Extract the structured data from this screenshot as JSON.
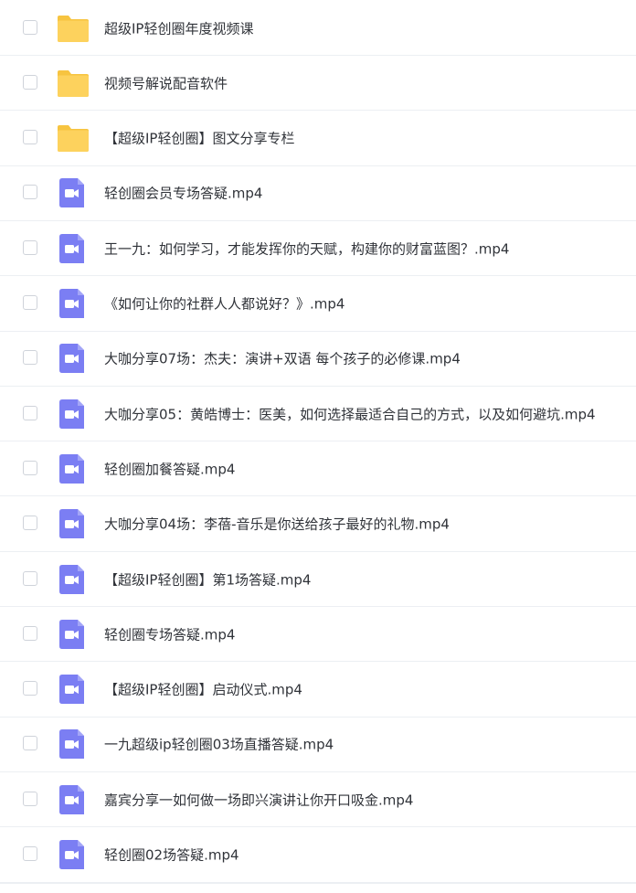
{
  "colors": {
    "folder": "#fdd25d",
    "folder_tab": "#f7c440",
    "video": "#7b7ef3",
    "text": "#303339",
    "divider": "#eceff3",
    "checkbox_border": "#cfd3da"
  },
  "files": [
    {
      "name": "超级IP轻创圈年度视频课",
      "type": "folder",
      "icon": "folder-icon"
    },
    {
      "name": "视频号解说配音软件",
      "type": "folder",
      "icon": "folder-icon"
    },
    {
      "name": "【超级IP轻创圈】图文分享专栏",
      "type": "folder",
      "icon": "folder-icon"
    },
    {
      "name": "轻创圈会员专场答疑.mp4",
      "type": "video",
      "icon": "video-file-icon"
    },
    {
      "name": "王一九：如何学习，才能发挥你的天赋，构建你的财富蓝图？.mp4",
      "type": "video",
      "icon": "video-file-icon"
    },
    {
      "name": "《如何让你的社群人人都说好？》.mp4",
      "type": "video",
      "icon": "video-file-icon"
    },
    {
      "name": "大咖分享07场：杰夫：演讲+双语 每个孩子的必修课.mp4",
      "type": "video",
      "icon": "video-file-icon"
    },
    {
      "name": "大咖分享05：黄皓博士：医美，如何选择最适合自己的方式，以及如何避坑.mp4",
      "type": "video",
      "icon": "video-file-icon"
    },
    {
      "name": "轻创圈加餐答疑.mp4",
      "type": "video",
      "icon": "video-file-icon"
    },
    {
      "name": "大咖分享04场：李蓓-音乐是你送给孩子最好的礼物.mp4",
      "type": "video",
      "icon": "video-file-icon"
    },
    {
      "name": "【超级IP轻创圈】第1场答疑.mp4",
      "type": "video",
      "icon": "video-file-icon"
    },
    {
      "name": "轻创圈专场答疑.mp4",
      "type": "video",
      "icon": "video-file-icon"
    },
    {
      "name": "【超级IP轻创圈】启动仪式.mp4",
      "type": "video",
      "icon": "video-file-icon"
    },
    {
      "name": "一九超级ip轻创圈03场直播答疑.mp4",
      "type": "video",
      "icon": "video-file-icon"
    },
    {
      "name": "嘉宾分享一如何做一场即兴演讲让你开口吸金.mp4",
      "type": "video",
      "icon": "video-file-icon"
    },
    {
      "name": "轻创圈02场答疑.mp4",
      "type": "video",
      "icon": "video-file-icon"
    }
  ]
}
